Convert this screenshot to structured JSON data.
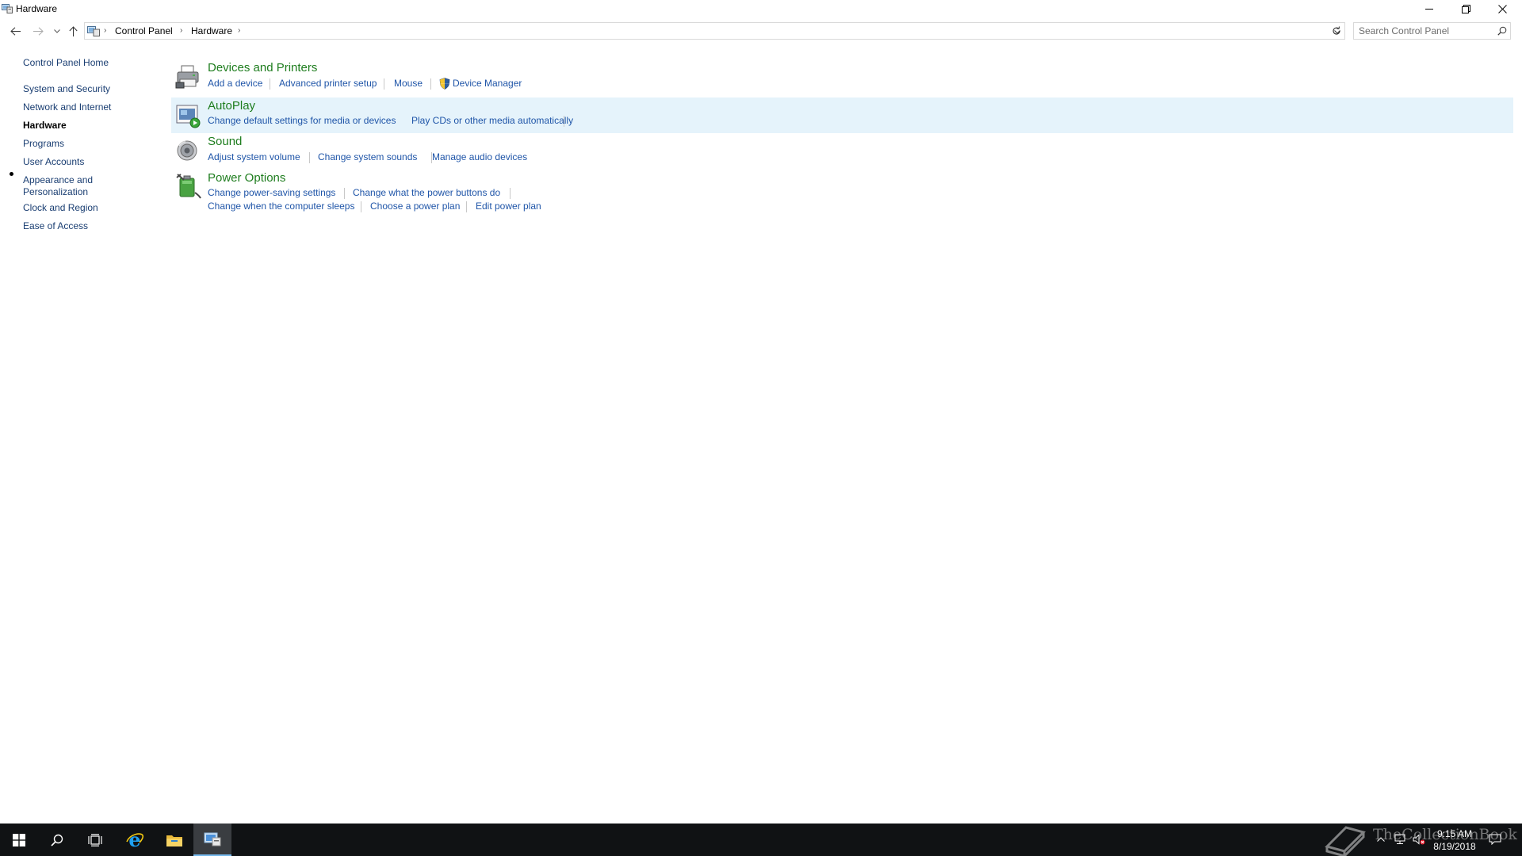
{
  "window": {
    "title": "Hardware"
  },
  "breadcrumb": {
    "items": [
      "Control Panel",
      "Hardware"
    ]
  },
  "search": {
    "placeholder": "Search Control Panel"
  },
  "left_nav": {
    "home": "Control Panel Home",
    "items": [
      {
        "label": "System and Security",
        "active": false
      },
      {
        "label": "Network and Internet",
        "active": false
      },
      {
        "label": "Hardware",
        "active": true
      },
      {
        "label": "Programs",
        "active": false
      },
      {
        "label": "User Accounts",
        "active": false
      },
      {
        "label": "Appearance and Personalization",
        "active": false
      },
      {
        "label": "Clock and Region",
        "active": false
      },
      {
        "label": "Ease of Access",
        "active": false
      }
    ]
  },
  "categories": [
    {
      "title": "Devices and Printers",
      "icon": "printer-icon",
      "tasks": [
        "Add a device",
        "Advanced printer setup",
        "Mouse",
        "Device Manager"
      ]
    },
    {
      "title": "AutoPlay",
      "icon": "autoplay-icon",
      "tasks": [
        "Change default settings for media or devices",
        "Play CDs or other media automatically"
      ]
    },
    {
      "title": "Sound",
      "icon": "speaker-icon",
      "tasks": [
        "Adjust system volume",
        "Change system sounds",
        "Manage audio devices"
      ]
    },
    {
      "title": "Power Options",
      "icon": "battery-icon",
      "tasks": [
        "Change power-saving settings",
        "Change what the power buttons do",
        "Change when the computer sleeps",
        "Choose a power plan",
        "Edit power plan"
      ]
    }
  ],
  "taskbar": {
    "apps": [
      "start-icon",
      "search-icon",
      "task-view-icon",
      "internet-explorer-icon",
      "file-explorer-icon",
      "control-panel-icon"
    ],
    "clock_time": "9:15 AM",
    "clock_date": "8/19/2018",
    "watermark": "TheCollectionBook"
  },
  "colors": {
    "link": "#1f55a8",
    "category_title": "#1e7d1e",
    "highlight": "#e5f3fb",
    "taskbar": "#101214"
  }
}
